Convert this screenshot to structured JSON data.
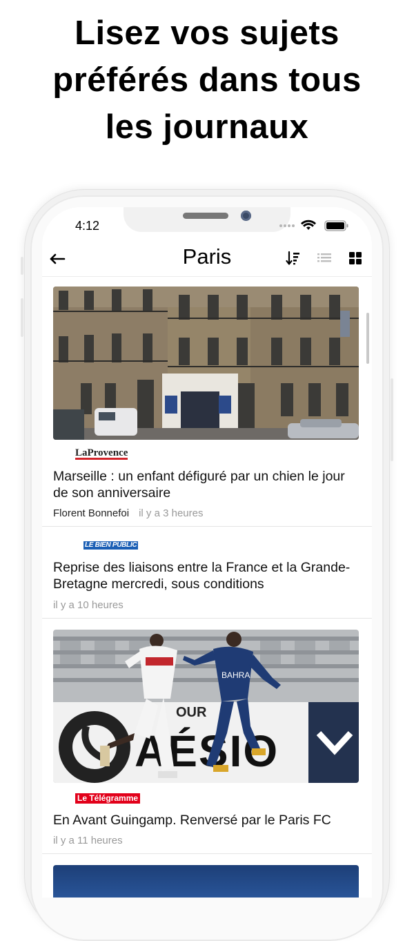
{
  "promo": {
    "line1": "Lisez vos sujets",
    "line2": "préférés dans tous",
    "line3": "les journaux"
  },
  "status_bar": {
    "time": "4:12"
  },
  "navbar": {
    "title": "Paris",
    "back_icon": "arrow-left-icon",
    "sort_icon": "sort-icon",
    "list_icon": "list-view-icon",
    "grid_icon": "grid-view-icon"
  },
  "articles": [
    {
      "source": "LaProvence",
      "title": "Marseille : un enfant défiguré par un chien le jour de son anniversaire",
      "author": "Florent Bonnefoi",
      "time": "il y a 3 heures"
    },
    {
      "source": "LE BIEN PUBLIC",
      "title": "Reprise des liaisons entre la France et la Grande-Bretagne mercredi, sous conditions",
      "time": "il y a 10 heures"
    },
    {
      "source": "Le Télégramme",
      "title": "En Avant Guingamp. Renversé par le Paris FC",
      "time": "il y a 11 heures"
    }
  ],
  "colors": {
    "laprovence_red": "#d2232a",
    "bienpublic_blue": "#1b5fb5",
    "telegramme_red": "#e2001a",
    "meta_gray": "#999999"
  }
}
